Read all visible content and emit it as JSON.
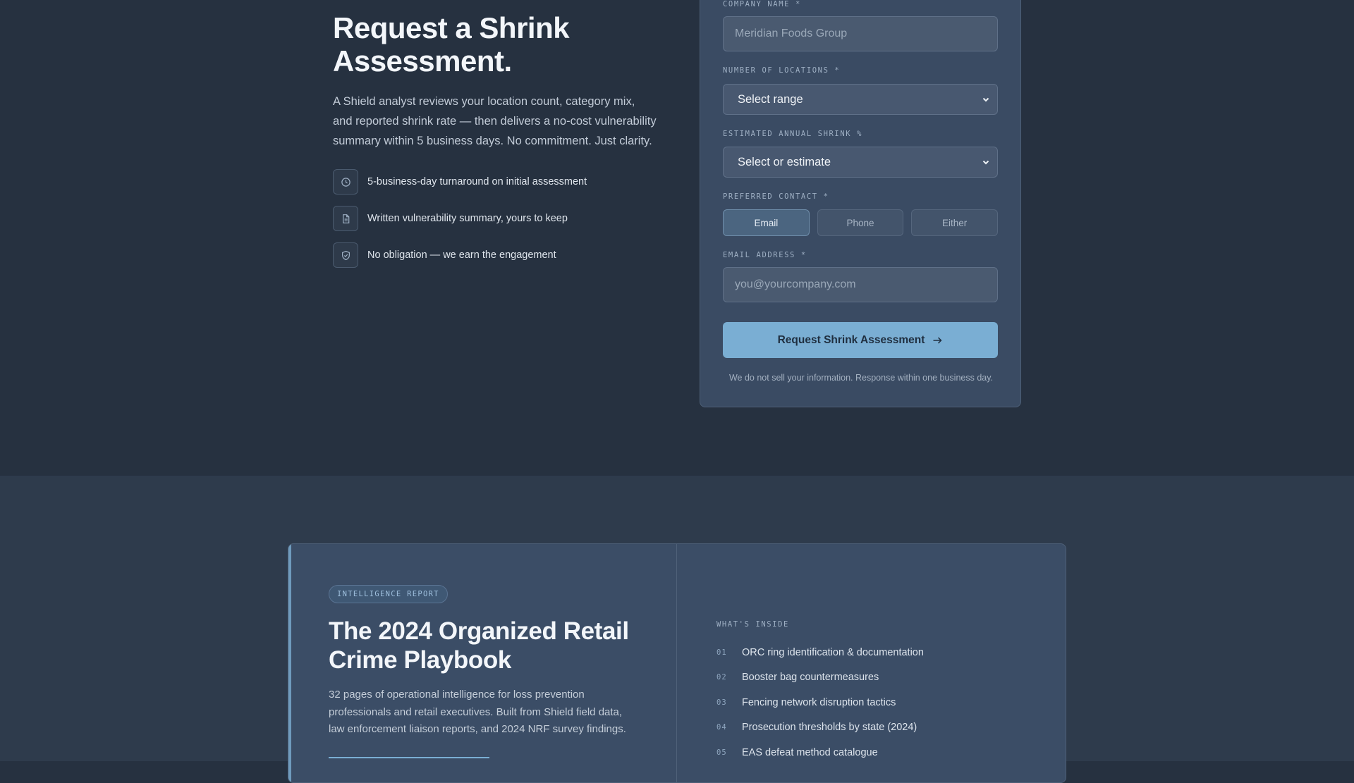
{
  "hero": {
    "title": "Request a Shrink Assessment.",
    "description": "A Shield analyst reviews your location count, category mix, and reported shrink rate — then delivers a no-cost vulnerability summary within 5 business days. No commitment. Just clarity.",
    "benefits": [
      {
        "icon": "clock-icon",
        "text": "5-business-day turnaround on initial assessment"
      },
      {
        "icon": "document-icon",
        "text": "Written vulnerability summary, yours to keep"
      },
      {
        "icon": "shield-check-icon",
        "text": "No obligation — we earn the engagement"
      }
    ]
  },
  "form": {
    "company_label": "COMPANY NAME *",
    "company_value": "",
    "company_placeholder": "Meridian Foods Group",
    "locations_label": "NUMBER OF LOCATIONS *",
    "locations_value": "Select range",
    "shrink_label": "ESTIMATED ANNUAL SHRINK %",
    "shrink_value": "Select or estimate",
    "contact_label": "PREFERRED CONTACT *",
    "contact_options": [
      "Email",
      "Phone",
      "Either"
    ],
    "contact_selected": "Email",
    "email_label": "EMAIL ADDRESS *",
    "email_value": "",
    "email_placeholder": "you@yourcompany.com",
    "submit_label": "Request Shrink Assessment",
    "disclaimer": "We do not sell your information. Response within one business day."
  },
  "report": {
    "badge": "INTELLIGENCE REPORT",
    "title": "The 2024 Organized Retail Crime Playbook",
    "description": "32 pages of operational intelligence for loss prevention professionals and retail executives. Built from Shield field data, law enforcement liaison reports, and 2024 NRF survey findings.",
    "inside_label": "WHAT'S INSIDE",
    "inside_items": [
      {
        "num": "01",
        "text": "ORC ring identification & documentation"
      },
      {
        "num": "02",
        "text": "Booster bag countermeasures"
      },
      {
        "num": "03",
        "text": "Fencing network disruption tactics"
      },
      {
        "num": "04",
        "text": "Prosecution thresholds by state (2024)"
      },
      {
        "num": "05",
        "text": "EAS defeat method catalogue"
      }
    ]
  },
  "colors": {
    "page_bg": "#263140",
    "card_bg": "#3a4b63",
    "accent": "#7aaed3"
  }
}
